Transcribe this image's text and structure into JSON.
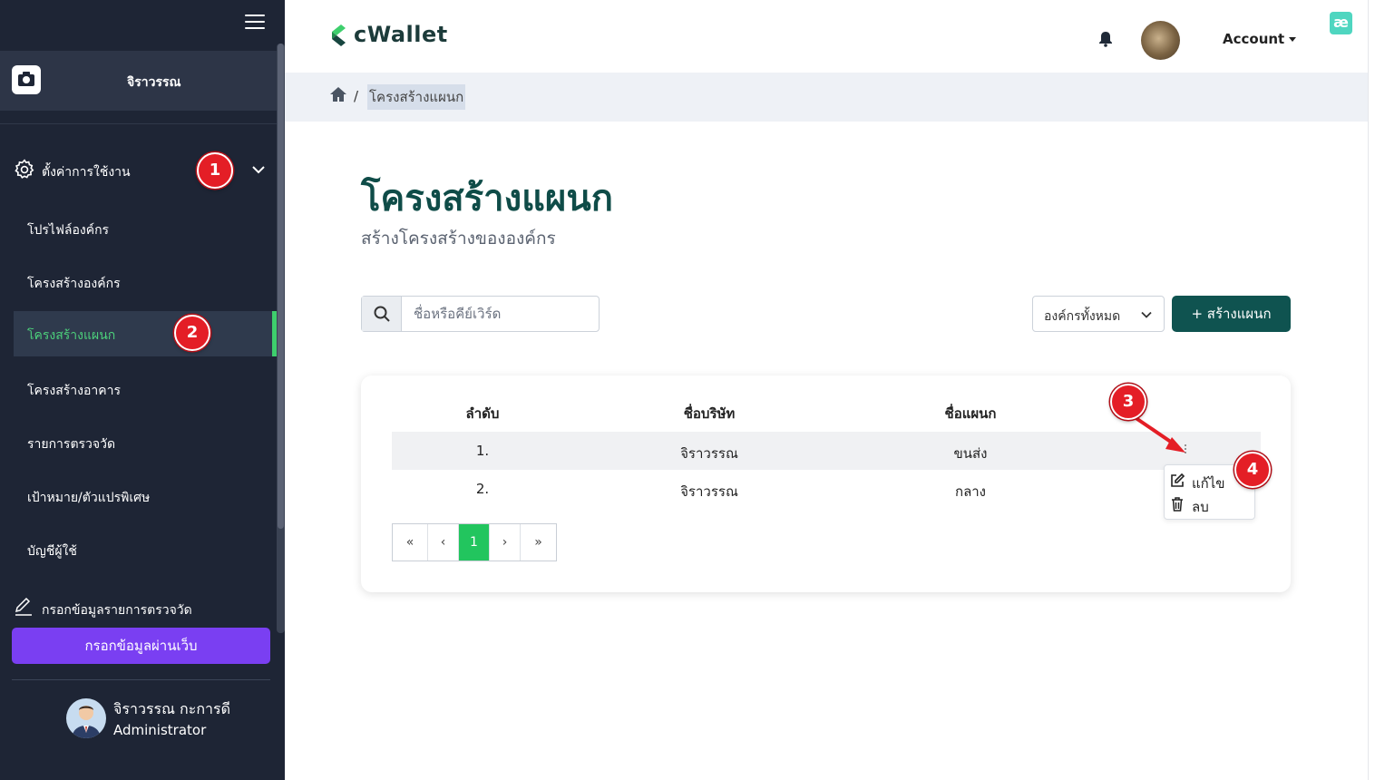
{
  "sidebar": {
    "org_name": "จิราวรรณ",
    "settings_label": "ตั้งค่าการใช้งาน",
    "items": [
      {
        "label": "โปรไฟล์องค์กร"
      },
      {
        "label": "โครงสร้างองค์กร"
      },
      {
        "label": "โครงสร้างแผนก"
      },
      {
        "label": "โครงสร้างอาคาร"
      },
      {
        "label": "รายการตรวจวัด"
      },
      {
        "label": "เป้าหมาย/ตัวแปรพิเศษ"
      },
      {
        "label": "บัญชีผู้ใช้"
      }
    ],
    "active_item": "โครงสร้างแผนก",
    "entry_label": "กรอกข้อมูลรายการตรวจวัด",
    "web_button": "กรอกข้อมูลผ่านเว็บ",
    "user": {
      "name": "จิราวรรณ กะการดี",
      "role": "Administrator"
    }
  },
  "header": {
    "logo_text": "cWallet",
    "account_label": "Account",
    "ext_icon_text": "æ"
  },
  "breadcrumb": {
    "separator": "/",
    "current": "โครงสร้างแผนก"
  },
  "main": {
    "title": "โครงสร้างแผนก",
    "subtitle": "สร้างโครงสร้างขององค์กร",
    "search_placeholder": "ชื่อหรือคีย์เวิร์ด",
    "org_filter": "องค์กรทั้งหมด",
    "add_button": "+ สร้างแผนก"
  },
  "table": {
    "headers": [
      "ลำดับ",
      "ชื่อบริษัท",
      "ชื่อแผนก"
    ],
    "rows": [
      [
        "1.",
        "จิราวรรณ",
        "ขนส่ง"
      ],
      [
        "2.",
        "จิราวรรณ",
        "กลาง"
      ]
    ]
  },
  "row_menu": {
    "edit": "แก้ไข",
    "delete": "ลบ"
  },
  "pagination": {
    "first": "«",
    "prev": "‹",
    "current": "1",
    "next": "›",
    "last": "»"
  },
  "markers": [
    "1",
    "2",
    "3",
    "4"
  ],
  "colors": {
    "sidebar_bg": "#1e2535",
    "active_green": "#3ecf6d",
    "primary_teal": "#0f5350",
    "web_button_purple": "#7a3ff2",
    "marker_red": "#e41e26",
    "page_active_green": "#22c55e"
  }
}
